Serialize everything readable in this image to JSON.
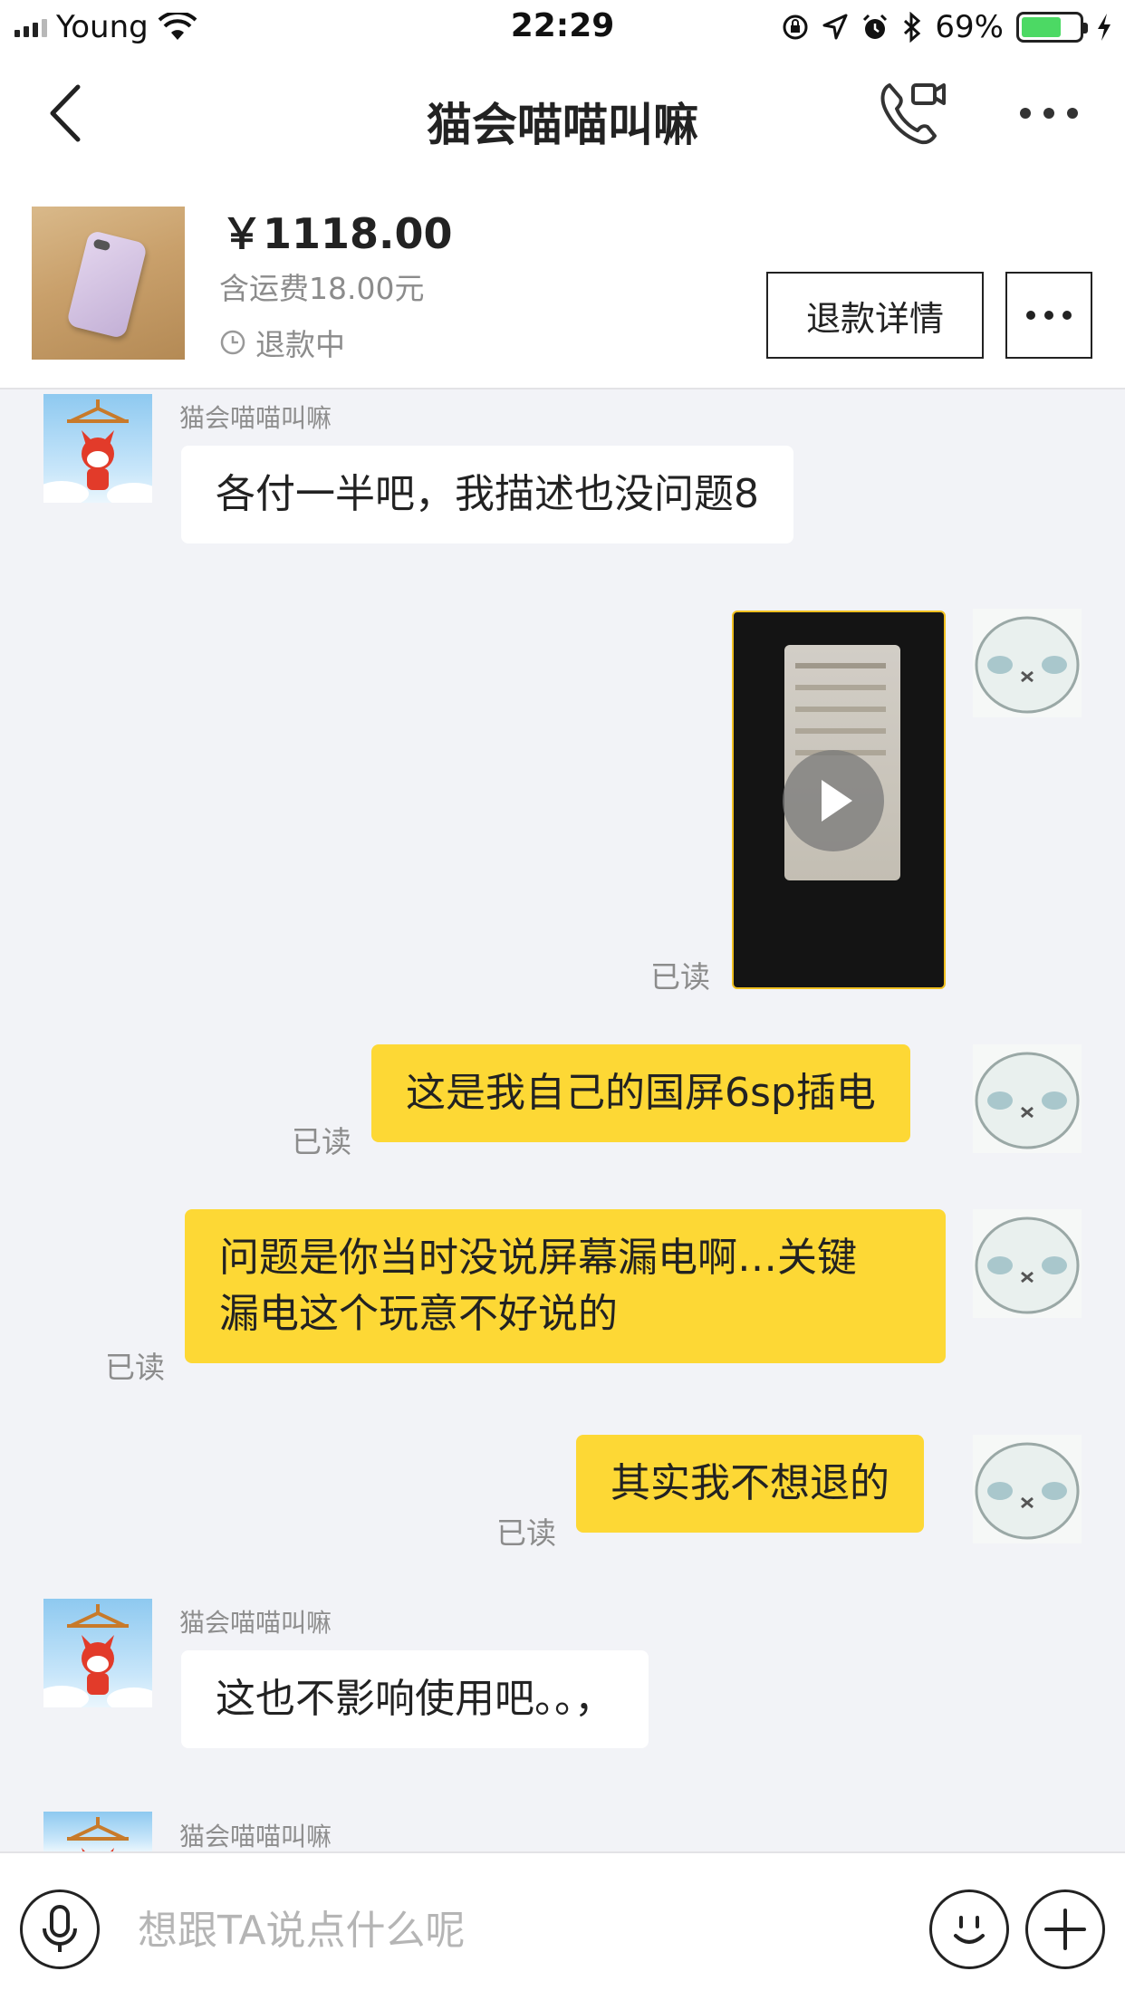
{
  "status_bar": {
    "carrier": "Young",
    "time": "22:29",
    "battery_percent": "69%",
    "battery_level": 0.69
  },
  "nav": {
    "title": "猫会喵喵叫嘛",
    "back_icon": "chevron-left-icon",
    "call_icon": "phone-video-icon",
    "more_icon": "more-dots-icon"
  },
  "product": {
    "price": "￥1118.00",
    "shipping": "含运费18.00元",
    "status": "退款中",
    "refund_button": "退款详情"
  },
  "messages": [
    {
      "side": "left",
      "sender": "猫会喵喵叫嘛",
      "text": "各付一半吧，我描述也没问题8"
    },
    {
      "side": "right",
      "type": "video",
      "read": "已读"
    },
    {
      "side": "right",
      "text": "这是我自己的国屏6sp插电",
      "read": "已读"
    },
    {
      "side": "right",
      "lines": [
        "问题是你当时没说屏幕漏电啊…关键",
        "漏电这个玩意不好说的"
      ],
      "read": "已读"
    },
    {
      "side": "right",
      "text": "其实我不想退的",
      "read": "已读"
    },
    {
      "side": "left",
      "sender": "猫会喵喵叫嘛",
      "text": "这也不影响使用吧。。，"
    },
    {
      "side": "left",
      "sender": "猫会喵喵叫嘛"
    }
  ],
  "input_bar": {
    "placeholder": "想跟TA说点什么呢"
  },
  "colors": {
    "accent_yellow": "#fdd835",
    "chat_background": "#f2f3f7",
    "battery_green": "#4cd964"
  }
}
